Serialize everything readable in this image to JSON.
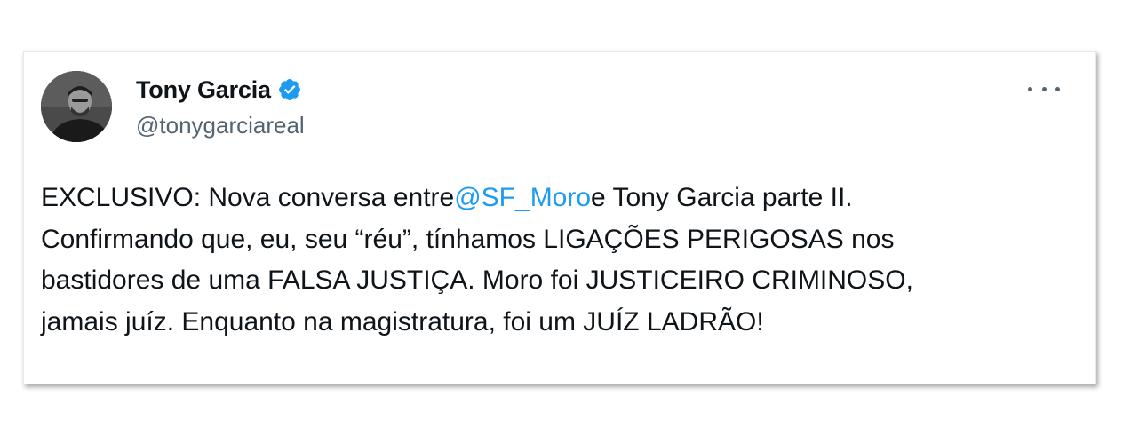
{
  "user": {
    "display_name": "Tony Garcia",
    "handle": "@tonygarciareal",
    "verified": true
  },
  "tweet": {
    "part1": "EXCLUSIVO: Nova conversa entre",
    "mention": "@SF_Moro",
    "part2": "e Tony Garcia parte II.\nConfirmando que, eu, seu “réu”, tínhamos LIGAÇÕES PERIGOSAS nos\nbastidores de uma FALSA JUSTIÇA. Moro foi JUSTICEIRO CRIMINOSO,\njamais juíz. Enquanto na magistratura, foi um JUÍZ LADRÃO!"
  },
  "icons": {
    "verified": "verified-badge-icon",
    "more": "more-options-icon"
  },
  "colors": {
    "text": "#0f1419",
    "secondary": "#536471",
    "link": "#1d9bf0",
    "verified": "#1d9bf0"
  }
}
